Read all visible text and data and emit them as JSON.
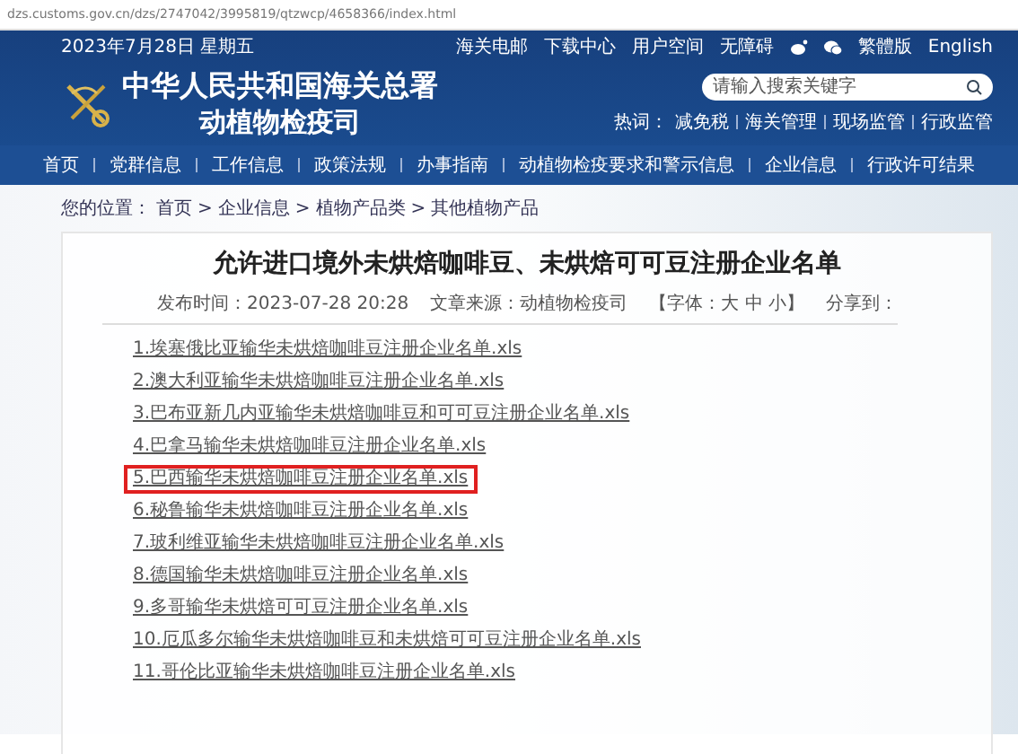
{
  "address_bar": {
    "url": "dzs.customs.gov.cn/dzs/2747042/3995819/qtzwcp/4658366/index.html"
  },
  "top_bar": {
    "date": "2023年7月28日 星期五",
    "links": [
      {
        "kind": "text",
        "label": "海关电邮"
      },
      {
        "kind": "text",
        "label": "下载中心"
      },
      {
        "kind": "text",
        "label": "用户空间"
      },
      {
        "kind": "text",
        "label": "无障碍"
      },
      {
        "kind": "weibo"
      },
      {
        "kind": "wechat"
      },
      {
        "kind": "text",
        "label": "繁體版"
      },
      {
        "kind": "text",
        "label": "English"
      }
    ]
  },
  "header": {
    "title_line_1": "中华人民共和国海关总署",
    "title_line_2": "动植物检疫司",
    "search": {
      "placeholder": "请输入搜索关键字"
    },
    "hot_words_label": "热词：",
    "hot_words": [
      "减免税",
      "海关管理",
      "现场监管",
      "行政监管"
    ]
  },
  "nav": [
    "首页",
    "党群信息",
    "工作信息",
    "政策法规",
    "办事指南",
    "动植物检疫要求和警示信息",
    "企业信息",
    "行政许可结果"
  ],
  "breadcrumb": {
    "label": "您的位置：",
    "separator": ">",
    "items": [
      "首页",
      "企业信息",
      "植物产品类",
      "其他植物产品"
    ]
  },
  "article": {
    "title": "允许进口境外未烘焙咖啡豆、未烘焙可可豆注册企业名单",
    "published": "发布时间：2023-07-28 20:28",
    "source": "文章来源：动植物检疫司",
    "font_size": "【字体：大 中 小】",
    "share": "分享到：",
    "attachments": [
      {
        "label": "1.埃塞俄比亚输华未烘焙咖啡豆注册企业名单.xls",
        "highlighted": false
      },
      {
        "label": "2.澳大利亚输华未烘焙咖啡豆注册企业名单.xls",
        "highlighted": false
      },
      {
        "label": "3.巴布亚新几内亚输华未烘焙咖啡豆和可可豆注册企业名单.xls",
        "highlighted": false
      },
      {
        "label": "4.巴拿马输华未烘焙咖啡豆注册企业名单.xls",
        "highlighted": false
      },
      {
        "label": "5.巴西输华未烘焙咖啡豆注册企业名单.xls",
        "highlighted": true
      },
      {
        "label": "6.秘鲁输华未烘焙咖啡豆注册企业名单.xls",
        "highlighted": false
      },
      {
        "label": "7.玻利维亚输华未烘焙咖啡豆注册企业名单.xls",
        "highlighted": false
      },
      {
        "label": "8.德国输华未烘焙咖啡豆注册企业名单.xls",
        "highlighted": false
      },
      {
        "label": "9.多哥输华未烘焙可可豆注册企业名单.xls",
        "highlighted": false
      },
      {
        "label": "10.厄瓜多尔输华未烘焙咖啡豆和未烘焙可可豆注册企业名单.xls",
        "highlighted": false
      },
      {
        "label": "11.哥伦比亚输华未烘焙咖啡豆注册企业名单.xls",
        "highlighted": false
      }
    ]
  }
}
